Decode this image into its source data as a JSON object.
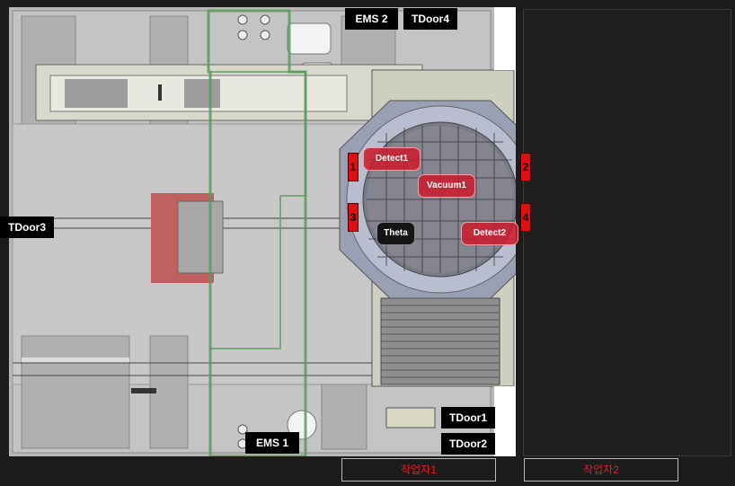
{
  "tags": {
    "ems2": "EMS 2",
    "tdoor4": "TDoor4",
    "tdoor3": "TDoor3",
    "tdoor1": "TDoor1",
    "tdoor2": "TDoor2",
    "ems1": "EMS 1"
  },
  "sensors": {
    "detect1": "Detect1",
    "vacuum1": "Vacuum1",
    "theta": "Theta",
    "detect2": "Detect2"
  },
  "ports": [
    "1",
    "2",
    "3",
    "4"
  ],
  "workers": {
    "worker1": "작업자1",
    "worker2": "작업자2"
  },
  "colors": {
    "sensor_red": "#c81e2d",
    "worker_text": "#e02020",
    "zone_green": "#5a9a5a",
    "tag_bg": "#000000"
  }
}
